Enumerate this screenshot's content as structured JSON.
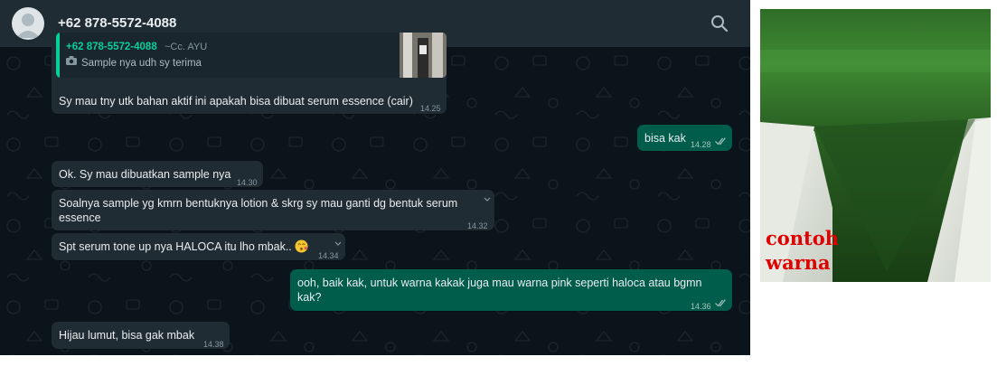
{
  "header": {
    "contact_name": "+62 878-5572-4088"
  },
  "quoted": {
    "author": "+62 878-5572-4088",
    "alias": "~Cc. AYU",
    "text": "Sample nya udh sy terima"
  },
  "messages": [
    {
      "dir": "in",
      "text": "Sy mau tny utk bahan aktif ini apakah bisa dibuat serum essence (cair)",
      "time": "14.25"
    },
    {
      "dir": "out",
      "text": "bisa kak",
      "time": "14.28"
    },
    {
      "dir": "in",
      "text": "Ok. Sy mau dibuatkan sample nya",
      "time": "14.30"
    },
    {
      "dir": "in",
      "text_line1": "Soalnya sample yg kmrn bentuknya lotion & skrg sy mau ganti dg bentuk serum",
      "text_line2": "essence",
      "time": "14.32"
    },
    {
      "dir": "in",
      "text": "Spt serum tone up nya HALOCA itu lho mbak..",
      "time": "14.34"
    },
    {
      "dir": "out",
      "text_line1": "ooh, baik kak, untuk warna kakak juga mau warna pink seperti haloca atau bgmn",
      "text_line2": "kak?",
      "time": "14.36"
    },
    {
      "dir": "in",
      "text": "Hijau lumut, bisa gak mbak",
      "time": "14.38"
    }
  ],
  "photo": {
    "caption_line1": "contoh",
    "caption_line2": "warna"
  },
  "icons": {
    "search": "search-icon",
    "avatar": "avatar-icon",
    "read": "double-check-icon",
    "menu": "chevron-down-icon",
    "camera": "camera-icon",
    "emoji": "kissing-face-emoji"
  },
  "colors": {
    "header": "#202c33",
    "background": "#0b141a",
    "incoming": "#202c33",
    "outgoing": "#005c4b",
    "accent": "#06cf9c",
    "caption": "#e00000"
  }
}
